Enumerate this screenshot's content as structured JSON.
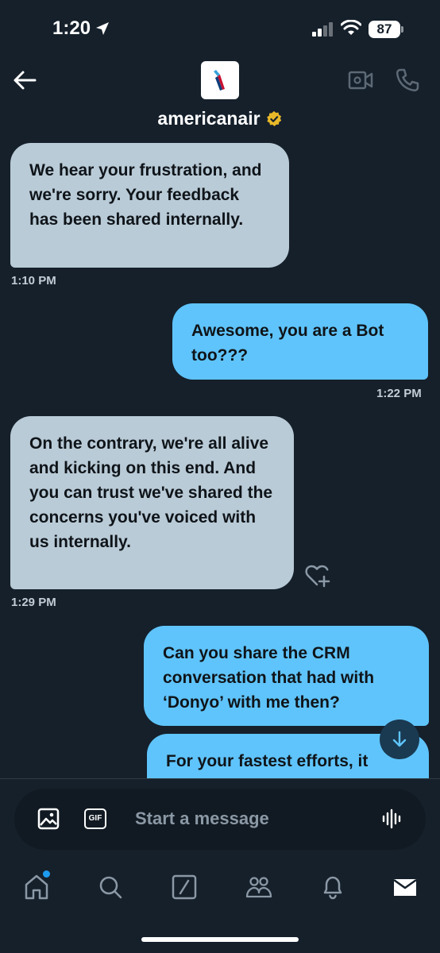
{
  "status_bar": {
    "time": "1:20",
    "battery": "87"
  },
  "header": {
    "handle": "americanair"
  },
  "messages": [
    {
      "direction": "in",
      "text": "We hear your frustration, and we're sorry. Your feedback has been shared internally.",
      "time": "1:10 PM"
    },
    {
      "direction": "out",
      "text": "Awesome, you are a Bot too???",
      "time": "1:22 PM"
    },
    {
      "direction": "in",
      "text": "On the contrary, we're all alive and kicking on this end. And you can trust we've shared the concerns you've voiced with us internally.",
      "time": "1:29 PM"
    },
    {
      "direction": "out",
      "text": "Can you share the CRM conversation that had with ‘Donyo’ with me then?"
    },
    {
      "direction": "out",
      "text": "For your fastest efforts, it"
    }
  ],
  "composer": {
    "placeholder": "Start a message",
    "gif_label": "GIF"
  },
  "icons": {
    "back": "back-arrow-icon",
    "video": "video-call-icon",
    "call": "phone-icon",
    "verified": "verified-badge-icon",
    "like": "heart-plus-icon",
    "image": "image-icon",
    "gif": "gif-icon",
    "voice": "voice-wave-icon",
    "scroll": "arrow-down-icon",
    "nav": [
      "home-icon",
      "search-icon",
      "grok-icon",
      "communities-icon",
      "notifications-icon",
      "messages-icon"
    ]
  },
  "colors": {
    "background": "#15202b",
    "incoming_bubble": "#b9cbd7",
    "outgoing_bubble": "#5fc4fb",
    "verified": "#e8b829",
    "accent": "#1d9bf0"
  }
}
